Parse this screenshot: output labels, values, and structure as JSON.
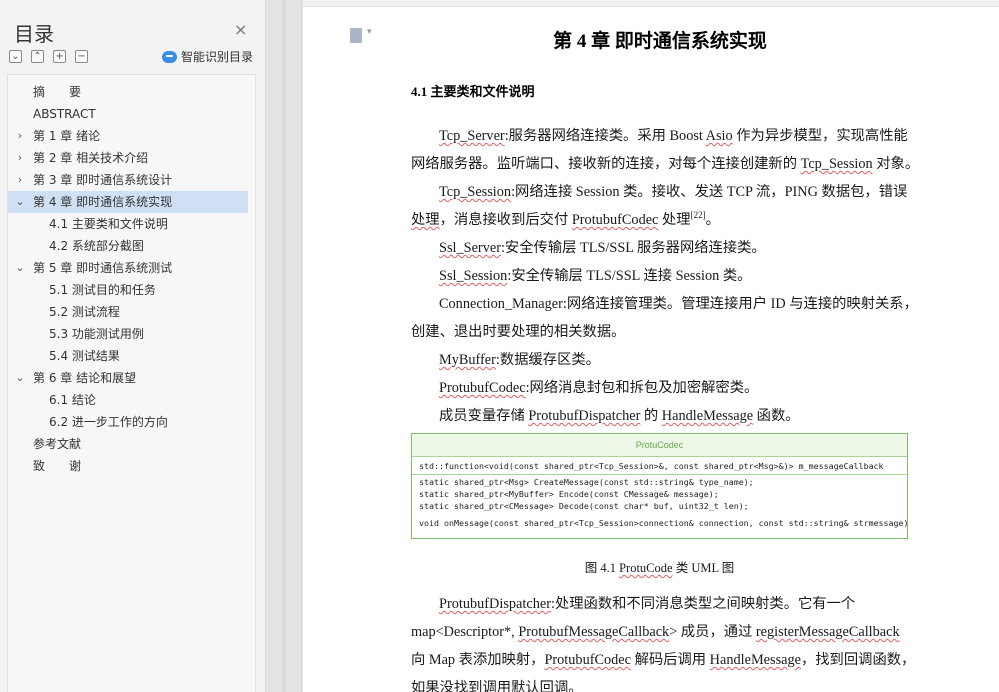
{
  "toc": {
    "title": "目录",
    "close_icon": "×",
    "tools": [
      "⌄",
      "⌃",
      "+",
      "−"
    ],
    "smart_label": "智能识别目录",
    "items": [
      {
        "text": "摘　　要",
        "level": 1,
        "arrow": ""
      },
      {
        "text": "ABSTRACT",
        "level": 1,
        "arrow": ""
      },
      {
        "text": "第 1 章  绪论",
        "level": 1,
        "arrow": "›"
      },
      {
        "text": "第 2 章  相关技术介绍",
        "level": 1,
        "arrow": "›"
      },
      {
        "text": "第 3 章  即时通信系统设计",
        "level": 1,
        "arrow": "›"
      },
      {
        "text": "第 4 章  即时通信系统实现",
        "level": 1,
        "arrow": "⌄",
        "active": true
      },
      {
        "text": "4.1 主要类和文件说明",
        "level": 2,
        "arrow": ""
      },
      {
        "text": "4.2 系统部分截图",
        "level": 2,
        "arrow": ""
      },
      {
        "text": "第 5 章  即时通信系统测试",
        "level": 1,
        "arrow": "⌄"
      },
      {
        "text": "5.1 测试目的和任务",
        "level": 2,
        "arrow": ""
      },
      {
        "text": "5.2 测试流程",
        "level": 2,
        "arrow": ""
      },
      {
        "text": "5.3  功能测试用例",
        "level": 2,
        "arrow": ""
      },
      {
        "text": "5.4  测试结果",
        "level": 2,
        "arrow": ""
      },
      {
        "text": "第 6 章  结论和展望",
        "level": 1,
        "arrow": "⌄"
      },
      {
        "text": "6.1  结论",
        "level": 2,
        "arrow": ""
      },
      {
        "text": "6.2  进一步工作的方向",
        "level": 2,
        "arrow": ""
      },
      {
        "text": "参考文献",
        "level": 1,
        "arrow": ""
      },
      {
        "text": "致　　谢",
        "level": 1,
        "arrow": ""
      }
    ]
  },
  "doc": {
    "chapter_title": "第 4 章  即时通信系统实现",
    "section_title": "4.1 主要类和文件说明",
    "paragraphs": {
      "p1a_w": "Tcp_Server",
      "p1a_t": ":服务器网络连接类。采用 Boost ",
      "p1a_w2": "Asio",
      "p1a_t2": " 作为异步模型，实现高性能",
      "p1b_t": "网络服务器。监听端口、接收新的连接，对每个连接创建新的 ",
      "p1b_w": "Tcp_Session",
      "p1b_t2": " 对象。",
      "p2a_w": "Tcp_Session",
      "p2a_t": ":网络连接 Session 类。接收、发送 TCP 流，PING 数据包，错误",
      "p2b_w0": "处理",
      "p2b_t": "，消息接收到后交付 ",
      "p2b_w": "ProtubufCodec",
      "p2b_t2": " 处理",
      "p2b_sup": "[22]",
      "p2b_t3": "。",
      "p3_w": "Ssl_Server",
      "p3_t": ":安全传输层 TLS/SSL 服务器网络连接类。",
      "p4_w": "Ssl_Session",
      "p4_t": ":安全传输层 TLS/SSL 连接 Session 类。",
      "p5a_t": "Connection_Manager:网络连接管理类。管理连接用户 ID 与连接的映射关系，",
      "p5b_t": "创建、退出时要处理的相关数据。",
      "p6_w": "MyBuffer",
      "p6_t": ":数据缓存区类。",
      "p7_w": "ProtubufCodec",
      "p7_t": ":网络消息封包和拆包及加密解密类。",
      "p8_t": "成员变量存储 ",
      "p8_w": "ProtubufDispatcher",
      "p8_t2": " 的 ",
      "p8_w2": "HandleMessage",
      "p8_t3": " 函数。",
      "p9a_w": "ProtubufDispatcher",
      "p9a_t": ":处理函数和不同消息类型之间映射类。它有一个",
      "p9b_t": "map<Descriptor*, ",
      "p9b_w": "ProtubufMessageCallback",
      "p9b_t2": ">  成员，通过 ",
      "p9b_w2": "registerMessageCallback",
      "p9c_t": "向 Map 表添加映射，",
      "p9c_w": "ProtubufCodec",
      "p9c_t2": " 解码后调用 ",
      "p9c_w2": "HandleMessage",
      "p9c_t3": "，找到回调函数，",
      "p10_t": "如果没找到调用默认回调。"
    },
    "uml": {
      "class_name": "ProtuCodec",
      "attr": "std::function<void(const shared_ptr<Tcp_Session>&, const shared_ptr<Msg>&)> m_messageCallback",
      "op1": "static shared_ptr<Msg> CreateMessage(const std::string& type_name);",
      "op2": "static shared_ptr<MyBuffer> Encode(const CMessage& message);",
      "op3": "static shared_ptr<CMessage>  Decode(const char* buf, uint32_t len);",
      "op4": "void onMessage(const shared_ptr<Tcp_Session>connection& connection, const std::string& strmessage);"
    },
    "caption_pre": "图 4.1 ",
    "caption_word": "ProtuCode",
    "caption_post": " 类 UML 图"
  },
  "icons": {
    "document": "document-icon",
    "close": "close-icon",
    "smart": "smart-recognize-icon"
  },
  "colors": {
    "toc_active": "#cfdff4",
    "uml_border": "#7fbf6a",
    "uml_title": "#6aa84f",
    "spell_underline": "#e06060"
  }
}
